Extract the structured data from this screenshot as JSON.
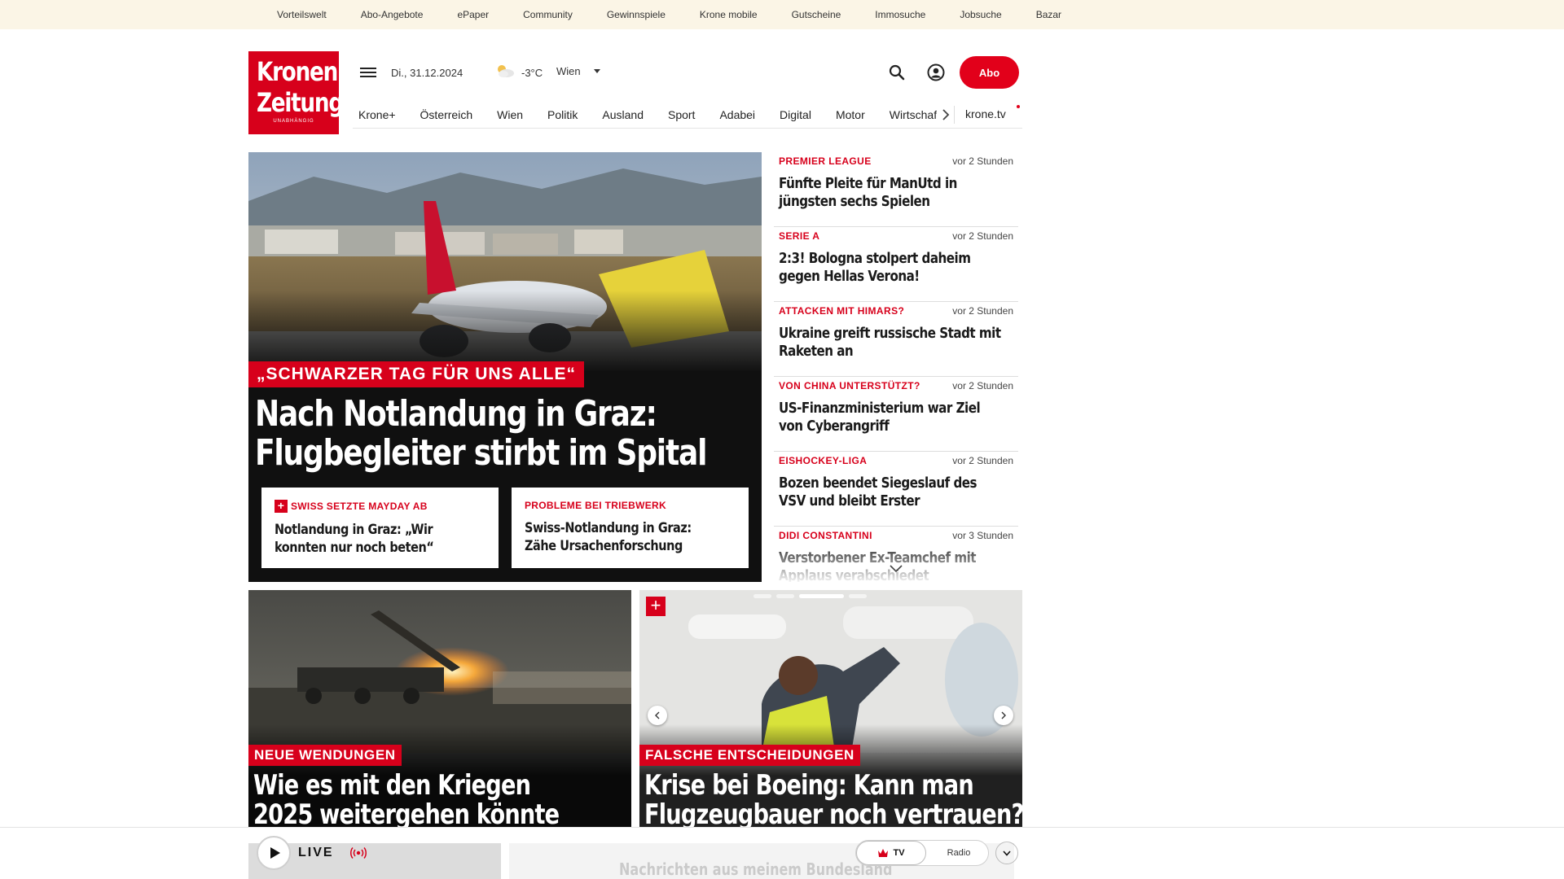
{
  "topbar": {
    "links": [
      "Vorteilswelt",
      "Abo-Angebote",
      "ePaper",
      "Community",
      "Gewinnspiele",
      "Krone mobile",
      "Gutscheine",
      "Immosuche",
      "Jobsuche",
      "Bazar"
    ]
  },
  "logo": {
    "line1": "Kronen",
    "line2": "Zeitung",
    "tagline": "UNABHÄNGIG"
  },
  "header": {
    "date": "Di., 31.12.2024",
    "weather_icon": "partly-cloudy-icon",
    "temperature": "-3°C",
    "city": "Wien",
    "abo_label": "Abo"
  },
  "nav": {
    "items": [
      "Krone+",
      "Österreich",
      "Wien",
      "Politik",
      "Ausland",
      "Sport",
      "Adabei",
      "Digital",
      "Motor",
      "Wirtschaft"
    ],
    "tv_label": "krone.tv"
  },
  "hero": {
    "kicker": "„SCHWARZER TAG FÜR UNS ALLE“",
    "title_line1": "Nach Notlandung in Graz:",
    "title_line2": "Flugbegleiter stirbt im Spital",
    "cards": [
      {
        "kicker": "SWISS SETZTE MAYDAY AB",
        "plus": true,
        "title_line1": "Notlandung in Graz: „Wir",
        "title_line2": "konnten nur noch beten“"
      },
      {
        "kicker": "PROBLEME BEI TRIEBWERK",
        "plus": false,
        "title_line1": "Swiss-Notlandung in Graz:",
        "title_line2": "Zähe Ursachenforschung"
      }
    ]
  },
  "ticker": {
    "items": [
      {
        "kicker": "PREMIER LEAGUE",
        "time": "vor 2 Stunden",
        "title_line1": "Fünfte Pleite für ManUtd in",
        "title_line2": "jüngsten sechs Spielen"
      },
      {
        "kicker": "SERIE A",
        "time": "vor 2 Stunden",
        "title_line1": "2:3! Bologna stolpert daheim",
        "title_line2": "gegen Hellas Verona!"
      },
      {
        "kicker": "ATTACKEN MIT HIMARS?",
        "time": "vor 2 Stunden",
        "title_line1": "Ukraine greift russische Stadt mit",
        "title_line2": "Raketen an"
      },
      {
        "kicker": "VON CHINA UNTERSTÜTZT?",
        "time": "vor 2 Stunden",
        "title_line1": "US-Finanzministerium war Ziel",
        "title_line2": "von Cyberangriff"
      },
      {
        "kicker": "EISHOCKEY-LIGA",
        "time": "vor 2 Stunden",
        "title_line1": "Bozen beendet Siegeslauf des",
        "title_line2": "VSV und bleibt Erster"
      },
      {
        "kicker": "DIDI CONSTANTINI",
        "time": "vor 3 Stunden",
        "title_line1": "Verstorbener Ex-Teamchef mit",
        "title_line2": "Applaus verabschiedet"
      }
    ]
  },
  "lower": [
    {
      "kicker": "NEUE WENDUNGEN",
      "title_line1": "Wie es mit den Kriegen",
      "title_line2": "2025 weitergehen könnte"
    },
    {
      "kicker": "FALSCHE ENTSCHEIDUNGEN",
      "title_line1": "Krise bei Boeing: Kann man",
      "title_line2": "Flugzeugbauer noch vertrauen?"
    }
  ],
  "behind_text": "Nachrichten aus meinem Bundesland",
  "livebar": {
    "live_label": "LIVE",
    "tv_label": "TV",
    "radio_label": "Radio"
  },
  "colors": {
    "brand_red": "#d7001b",
    "topbar_bg": "#fbf5e6"
  }
}
